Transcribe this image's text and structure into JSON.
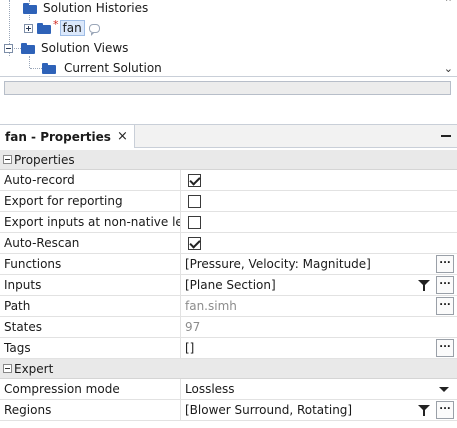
{
  "tree": {
    "items": [
      {
        "label": "Solution Histories",
        "icon": "folder-icon"
      },
      {
        "label": "fan",
        "modified_marker": "*",
        "icon": "folder-icon",
        "comment_icon": "comment-icon"
      },
      {
        "label": "Solution Views",
        "icon": "folder-icon"
      },
      {
        "label": "Current Solution",
        "icon": "folder-icon"
      }
    ]
  },
  "properties_panel": {
    "tab_title": "fan - Properties",
    "close_glyph": "×",
    "sections": {
      "properties": {
        "label": "Properties",
        "rows": [
          {
            "name": "Auto-record",
            "checked": true
          },
          {
            "name": "Export for reporting",
            "checked": false
          },
          {
            "name": "Export inputs at non-native le",
            "checked": false
          },
          {
            "name": "Auto-Rescan",
            "checked": true
          },
          {
            "name": "Functions",
            "value": "[Pressure, Velocity: Magnitude]",
            "button": "..."
          },
          {
            "name": "Inputs",
            "value": "[Plane Section]",
            "button": "..."
          },
          {
            "name": "Path",
            "value": "fan.simh",
            "button": "..."
          },
          {
            "name": "States",
            "value": "97"
          },
          {
            "name": "Tags",
            "value": "[]",
            "button": "..."
          }
        ]
      },
      "expert": {
        "label": "Expert",
        "rows": [
          {
            "name": "Compression mode",
            "value": "Lossless"
          },
          {
            "name": "Regions",
            "value": "[Blower Surround, Rotating]",
            "button": "..."
          }
        ]
      }
    }
  }
}
